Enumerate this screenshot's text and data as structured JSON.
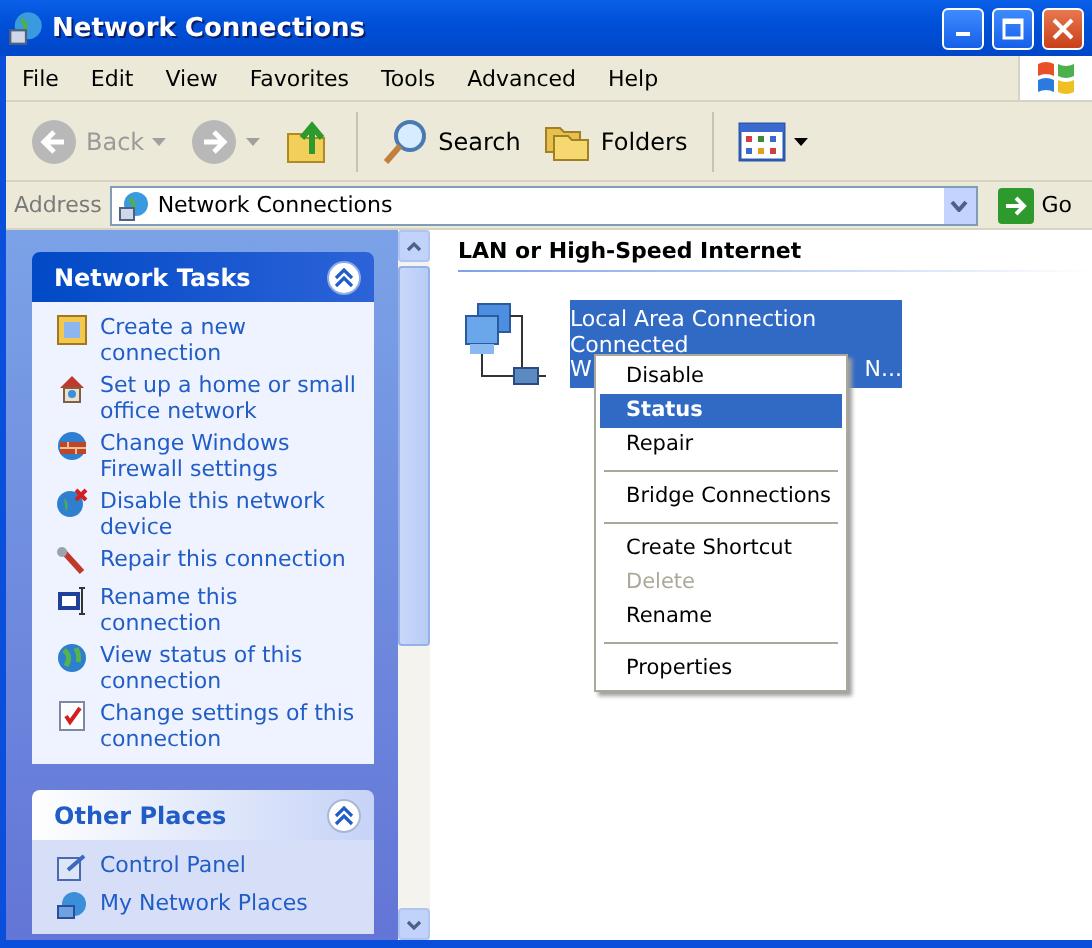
{
  "window": {
    "title": "Network Connections"
  },
  "menu_bar": [
    "File",
    "Edit",
    "View",
    "Favorites",
    "Tools",
    "Advanced",
    "Help"
  ],
  "toolbar": [
    {
      "kind": "back",
      "label": "Back",
      "disabled": true
    },
    {
      "kind": "forward",
      "disabled": true
    },
    {
      "kind": "up",
      "disabled": false
    },
    {
      "kind": "search",
      "label": "Search",
      "disabled": false
    },
    {
      "kind": "folders",
      "label": "Folders",
      "disabled": false
    },
    {
      "kind": "views",
      "disabled": false
    }
  ],
  "address_bar": {
    "label": "Address",
    "value": "Network Connections",
    "go_label": "Go"
  },
  "sidebar": {
    "panels": [
      {
        "title": "Network Tasks",
        "kind": "primary",
        "expanded": true,
        "items": [
          {
            "kind": "wizard",
            "label": "Create a new connection"
          },
          {
            "kind": "home",
            "label": "Set up a home or small office network"
          },
          {
            "kind": "firewall",
            "label": "Change Windows Firewall settings"
          },
          {
            "kind": "disable",
            "label": "Disable this network device"
          },
          {
            "kind": "repair",
            "label": "Repair this connection"
          },
          {
            "kind": "rename",
            "label": "Rename this connection"
          },
          {
            "kind": "status",
            "label": "View status of this connection"
          },
          {
            "kind": "settings",
            "label": "Change settings of this connection"
          }
        ]
      },
      {
        "title": "Other Places",
        "kind": "normal",
        "expanded": true,
        "items": [
          {
            "kind": "control-panel",
            "label": "Control Panel"
          },
          {
            "kind": "network-places",
            "label": "My Network Places"
          }
        ]
      }
    ]
  },
  "content": {
    "group_title": "LAN or High-Speed Internet",
    "connection": {
      "name": "Local Area Connection",
      "status": "Connected",
      "line_3_start": "W",
      "line_3_end": "N...",
      "selected": true
    }
  },
  "context_menu": [
    {
      "kind": "item",
      "label": "Disable",
      "selected": false,
      "default": false,
      "disabled": false
    },
    {
      "kind": "item",
      "label": "Status",
      "selected": true,
      "default": true,
      "disabled": false
    },
    {
      "kind": "item",
      "label": "Repair",
      "selected": false,
      "default": false,
      "disabled": false
    },
    {
      "kind": "separator"
    },
    {
      "kind": "item",
      "label": "Bridge Connections",
      "selected": false,
      "default": false,
      "disabled": false
    },
    {
      "kind": "separator"
    },
    {
      "kind": "item",
      "label": "Create Shortcut",
      "selected": false,
      "default": false,
      "disabled": false
    },
    {
      "kind": "item",
      "label": "Delete",
      "selected": false,
      "default": false,
      "disabled": true
    },
    {
      "kind": "item",
      "label": "Rename",
      "selected": false,
      "default": false,
      "disabled": false
    },
    {
      "kind": "separator"
    },
    {
      "kind": "item",
      "label": "Properties",
      "selected": false,
      "default": false,
      "disabled": false
    }
  ]
}
